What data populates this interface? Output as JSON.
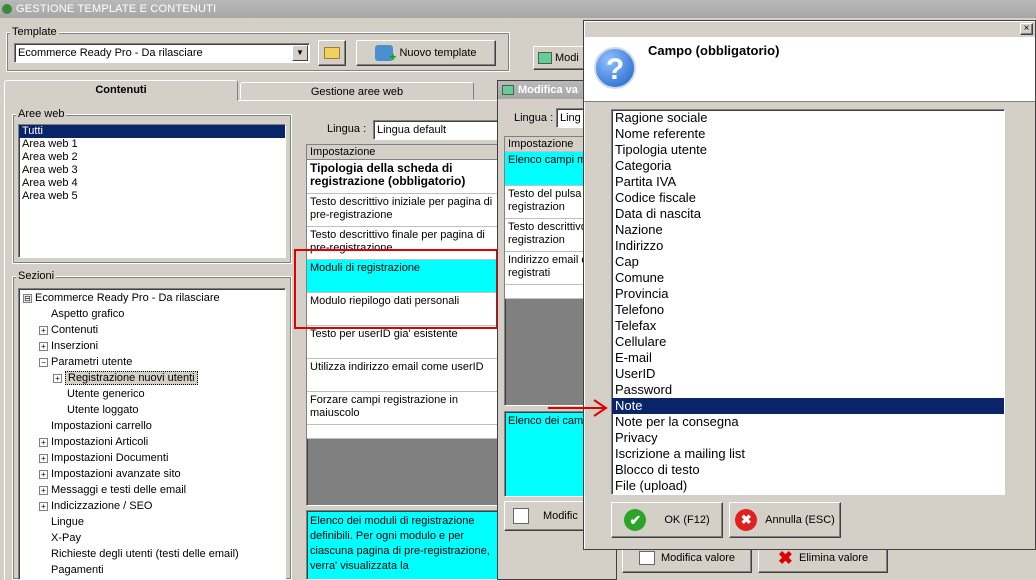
{
  "window": {
    "title": "GESTIONE TEMPLATE E CONTENUTI"
  },
  "template": {
    "group_label": "Template",
    "selected": "Ecommerce Ready Pro - Da rilasciare",
    "new_button": "Nuovo template"
  },
  "tabs": [
    "Contenuti",
    "Gestione aree web"
  ],
  "aree_web": {
    "label": "Aree web",
    "items": [
      "Tutti",
      "Area web 1",
      "Area web 2",
      "Area web 3",
      "Area web 4",
      "Area web 5"
    ]
  },
  "sezioni": {
    "label": "Sezioni",
    "items": [
      {
        "label": "Ecommerce Ready Pro - Da rilasciare",
        "pm": "⊟"
      },
      {
        "label": "Aspetto grafico",
        "pm": ""
      },
      {
        "label": "Contenuti",
        "pm": "+"
      },
      {
        "label": "Inserzioni",
        "pm": "+"
      },
      {
        "label": "Parametri utente",
        "pm": "−"
      },
      {
        "label": "Registrazione nuovi utenti",
        "pm": "+"
      },
      {
        "label": "Utente generico",
        "pm": ""
      },
      {
        "label": "Utente loggato",
        "pm": ""
      },
      {
        "label": "Impostazioni carrello",
        "pm": ""
      },
      {
        "label": "Impostazioni Articoli",
        "pm": "+"
      },
      {
        "label": "Impostazioni Documenti",
        "pm": "+"
      },
      {
        "label": "Impostazioni avanzate sito",
        "pm": "+"
      },
      {
        "label": "Messaggi e testi delle email",
        "pm": "+"
      },
      {
        "label": "Indicizzazione / SEO",
        "pm": "+"
      },
      {
        "label": "Lingue",
        "pm": ""
      },
      {
        "label": "X-Pay",
        "pm": ""
      },
      {
        "label": "Richieste degli utenti (testi delle email)",
        "pm": ""
      },
      {
        "label": "Pagamenti",
        "pm": ""
      }
    ]
  },
  "lingua": {
    "label": "Lingua :",
    "value": "Lingua default"
  },
  "impostazioni": {
    "header": "Impostazione",
    "rows": [
      "Tipologia della scheda di registrazione (obbligatorio)",
      "Testo descrittivo iniziale per pagina di pre-registrazione",
      "Testo descrittivo finale per pagina di pre-registrazione",
      "Moduli di registrazione",
      "Modulo riepilogo dati personali",
      "Testo per userID gia' esistente",
      "Utilizza indirizzo email come userID",
      "Forzare campi registrazione in maiuscolo"
    ],
    "description": "Elenco dei moduli di registrazione definibili. Per ogni modulo e per ciascuna pagina di pre-registrazione, verra' visualizzata la"
  },
  "right_button": "Modi",
  "modifica_window": {
    "title": "Modifica va",
    "lingua_label": "Lingua :",
    "lingua_value": "Ling",
    "header": "Impostazione",
    "rows": [
      "Elenco campi m",
      "Testo del pulsa pre-registrazion",
      "Testo descrittivo pre-registrazion",
      "Indirizzo email d registrati"
    ],
    "description": "Elenco dei camp",
    "button": "Modific"
  },
  "bottom_buttons": {
    "modifica": "Modifica valore",
    "elimina": "Elimina valore"
  },
  "dialog": {
    "title": "Campo (obbligatorio)",
    "icon": "question-icon",
    "items": [
      "Ragione sociale",
      "Nome referente",
      "Tipologia utente",
      "Categoria",
      "Partita IVA",
      "Codice fiscale",
      "Data di nascita",
      "Nazione",
      "Indirizzo",
      "Cap",
      "Comune",
      "Provincia",
      "Telefono",
      "Telefax",
      "Cellulare",
      "E-mail",
      "UserID",
      "Password",
      "Note",
      "Note per la consegna",
      "Privacy",
      "Iscrizione a mailing list",
      "Blocco di testo",
      "File (upload)"
    ],
    "selected_index": 18,
    "ok_label": "OK (F12)",
    "cancel_label": "Annulla (ESC)",
    "close_label": "×"
  },
  "colors": {
    "highlight": "#00ffff",
    "selection": "#0a246a",
    "annotation": "#e00000"
  }
}
